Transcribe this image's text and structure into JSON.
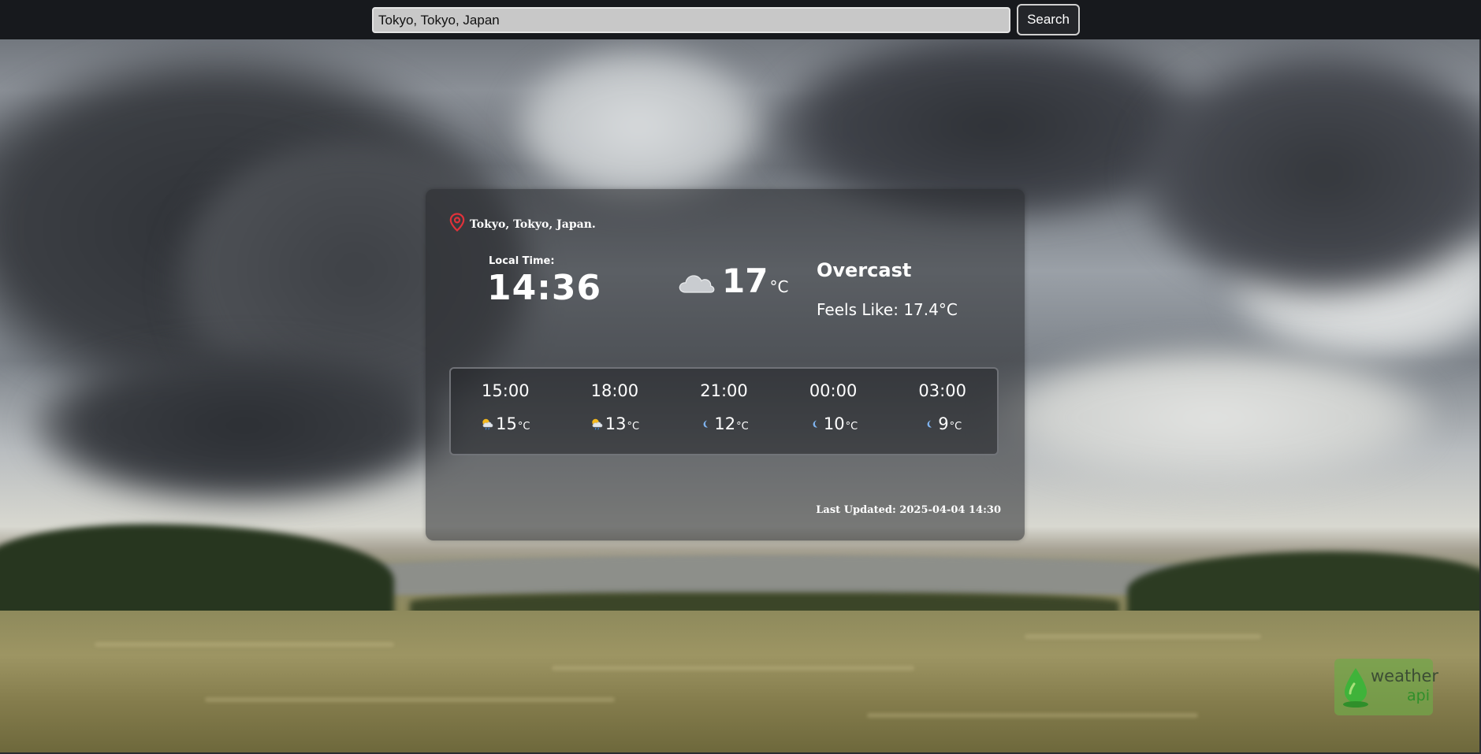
{
  "search": {
    "value": "Tokyo, Tokyo, Japan",
    "button_label": "Search"
  },
  "location": {
    "icon": "map-pin-icon",
    "text": "Tokyo, Tokyo, Japan."
  },
  "local_time": {
    "label": "Local Time:",
    "value": "14:36"
  },
  "current": {
    "icon": "cloud-icon",
    "temp": "17",
    "unit": "°C",
    "condition": "Overcast",
    "feels_like": "Feels Like: 17.4°C"
  },
  "forecast": [
    {
      "time": "15:00",
      "icon": "partly-cloudy-rain-icon",
      "temp": "15",
      "unit": "°C"
    },
    {
      "time": "18:00",
      "icon": "partly-cloudy-rain-icon",
      "temp": "13",
      "unit": "°C"
    },
    {
      "time": "21:00",
      "icon": "moon-icon",
      "temp": "12",
      "unit": "°C"
    },
    {
      "time": "00:00",
      "icon": "moon-icon",
      "temp": "10",
      "unit": "°C"
    },
    {
      "time": "03:00",
      "icon": "moon-icon",
      "temp": "9",
      "unit": "°C"
    }
  ],
  "last_updated": "Last Updated: 2025-04-04 14:30",
  "badge": {
    "icon": "weatherapi-logo-icon",
    "word": "weather",
    "api": "api"
  },
  "colors": {
    "pin": "#e0323a",
    "badge": "#70a848",
    "topbar": "#17191d"
  }
}
